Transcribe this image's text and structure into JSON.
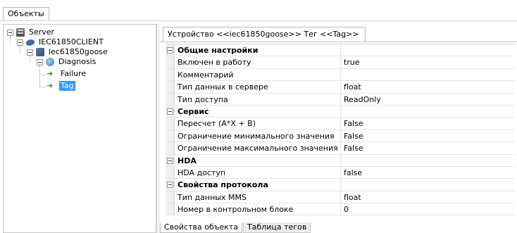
{
  "top_tab": {
    "label": "Объекты"
  },
  "tree": {
    "server": "Server",
    "client": "IEC61850CLIENT",
    "device": "iec61850goose",
    "diagnosis": "Diagnosis",
    "failure": "Failure",
    "tag": "Tag"
  },
  "device_tab": {
    "label": "Устройство <<iec61850goose>> Тег  <<Tag>>"
  },
  "properties": {
    "general": {
      "title": "Общие настройки",
      "rows": [
        {
          "name": "Включен в работу",
          "value": "true"
        },
        {
          "name": "Комментарий",
          "value": ""
        },
        {
          "name": "Тип данных в сервере",
          "value": "float"
        },
        {
          "name": "Тип доступа",
          "value": "ReadOnly"
        }
      ]
    },
    "service": {
      "title": "Сервис",
      "rows": [
        {
          "name": "Пересчет (A*X + B)",
          "value": "False"
        },
        {
          "name": "Ограничение минимального значения",
          "value": "False"
        },
        {
          "name": "Ограничение максимального значения",
          "value": "False"
        }
      ]
    },
    "hda": {
      "title": "HDA",
      "rows": [
        {
          "name": "HDA доступ",
          "value": "false"
        }
      ]
    },
    "protocol": {
      "title": "Свойства протокола",
      "rows": [
        {
          "name": "Тип данных MMS",
          "value": "float"
        },
        {
          "name": "Номер в контрольном блоке",
          "value": "0"
        }
      ]
    }
  },
  "bottom_tabs": {
    "object_props": "Свойства объекта",
    "tag_table": "Таблица тегов"
  },
  "colors": {
    "selection": "#3399ff",
    "arrow_green": "#2e9a2e",
    "gutter": "#f0f0f0"
  }
}
